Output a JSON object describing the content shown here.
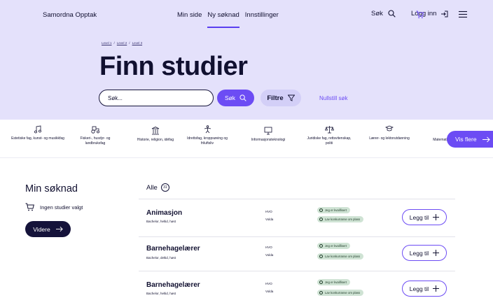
{
  "header": {
    "brand": "Samordna Opptak",
    "nav": [
      "Min side",
      "Ny søknad",
      "Innstillinger"
    ],
    "active_nav": "Ny søknad",
    "search_label": "Søk",
    "login_label": "Logg inn"
  },
  "breadcrumb": [
    "Level 1",
    "Level 2",
    "Level 3"
  ],
  "page_title": "Finn studier",
  "search": {
    "placeholder": "Søk...",
    "button_label": "Søk",
    "filter_label": "Filtre",
    "reset_label": "Nullstill søk"
  },
  "categories": [
    "Estetiske fag, kunst- og musikkfag",
    "Fiskeri-, husdyr- og landbruksfag",
    "Historie, religion, idéfag",
    "Idrettsfag, kroppsøving og friluftsliv",
    "Informasjonsteknologi",
    "Juridiske fag, rettsvitenskap, politi",
    "Lærer- og lektorutdanning",
    "Matematikk"
  ],
  "more_label": "Vis flere",
  "application": {
    "title": "Min søknad",
    "empty_text": "Ingen studier valgt",
    "next_label": "Videre"
  },
  "list": {
    "all_label": "Alle",
    "count": "31",
    "add_label": "Legg til",
    "tag_qualified": "Jeg er kvalifisert",
    "tag_competition": "Lav konkurranse om plass",
    "rows": [
      {
        "name": "Animasjon",
        "sub": "Bachelor, heltid, høst",
        "inst": "HVO",
        "place": "Volda"
      },
      {
        "name": "Barnehagelærer",
        "sub": "Bachelor, deltid, høst",
        "inst": "HVO",
        "place": "Volda"
      },
      {
        "name": "Barnehagelærer",
        "sub": "Bachelor, heltid, høst",
        "inst": "HVO",
        "place": "Volda"
      }
    ]
  },
  "colors": {
    "hero_bg": "#e4e1fb",
    "accent": "#6c4cf4",
    "dark": "#15133a",
    "tag_bg": "#cfe3d4"
  }
}
